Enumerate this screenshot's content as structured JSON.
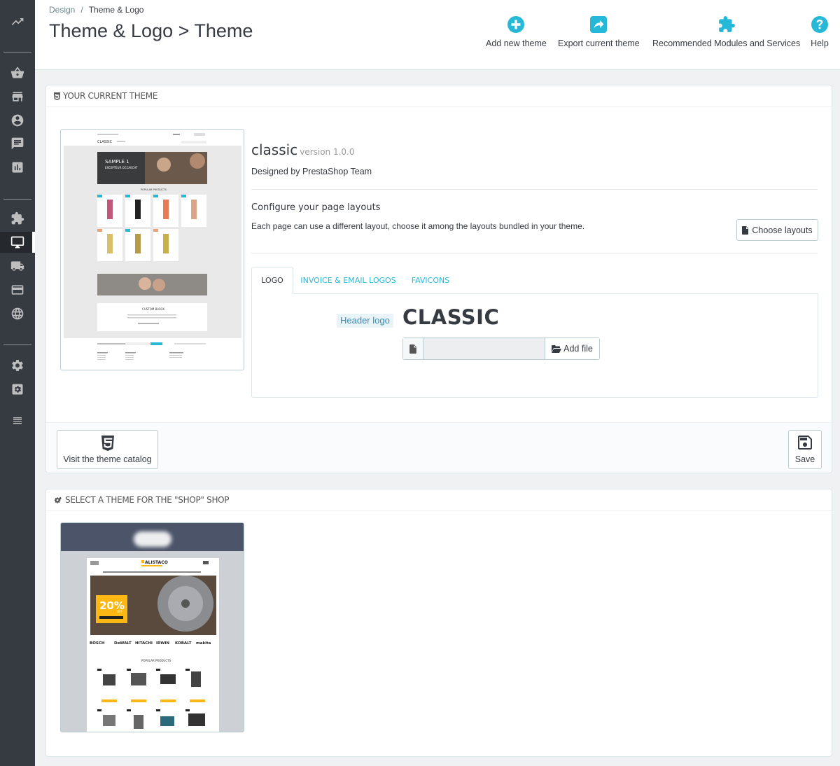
{
  "header": {
    "breadcrumb": [
      "Design",
      "Theme & Logo"
    ],
    "breadcrumb_sep": "/",
    "title": "Theme & Logo > Theme",
    "toolbar": [
      {
        "label": "Add new theme",
        "icon": "plus-circle-icon"
      },
      {
        "label": "Export current theme",
        "icon": "share-icon"
      },
      {
        "label": "Recommended Modules and Services",
        "icon": "puzzle-icon"
      },
      {
        "label": "Help",
        "icon": "help-icon"
      }
    ]
  },
  "sidebar": {
    "items": [
      {
        "name": "dashboard",
        "icon": "trending-up-icon"
      },
      {
        "name": "orders",
        "icon": "basket-icon"
      },
      {
        "name": "catalog",
        "icon": "store-icon"
      },
      {
        "name": "customers",
        "icon": "account-icon"
      },
      {
        "name": "customer-service",
        "icon": "chat-icon"
      },
      {
        "name": "stats",
        "icon": "bar-chart-icon"
      },
      {
        "name": "modules",
        "icon": "puzzle-icon"
      },
      {
        "name": "design",
        "icon": "desktop-icon",
        "active": true
      },
      {
        "name": "shipping",
        "icon": "truck-icon"
      },
      {
        "name": "payment",
        "icon": "credit-card-icon"
      },
      {
        "name": "international",
        "icon": "globe-icon"
      },
      {
        "name": "shop-parameters",
        "icon": "settings-icon"
      },
      {
        "name": "advanced-parameters",
        "icon": "settings-box-icon"
      },
      {
        "name": "more",
        "icon": "menu-icon"
      }
    ]
  },
  "current_theme": {
    "heading": "YOUR CURRENT THEME",
    "name": "classic",
    "version": "version 1.0.0",
    "designed_by": "Designed by PrestaShop Team",
    "layouts_title": "Configure your page layouts",
    "layouts_desc": "Each page can use a different layout, choose it among the layouts bundled in your theme.",
    "choose_layouts": "Choose layouts",
    "tabs": [
      {
        "label": "LOGO",
        "active": true
      },
      {
        "label": "INVOICE & EMAIL LOGOS",
        "active": false
      },
      {
        "label": "FAVICONS",
        "active": false
      }
    ],
    "header_logo_label": "Header logo",
    "logo_text": "CLASSIC",
    "add_file": "Add file",
    "visit_catalog": "Visit the theme catalog",
    "save": "Save",
    "preview": {
      "brand": "CLASSIC",
      "slide_title": "SAMPLE 1",
      "slide_sub": "EXCEPTEUR OCCAECAT",
      "section": "POPULAR PRODUCTS",
      "custom_block": "CUSTOM BLOCK"
    }
  },
  "select_theme": {
    "heading": "SELECT A THEME FOR THE \"SHOP\" SHOP",
    "card_preview": {
      "brand": "ALISTACO",
      "promo": "20%",
      "promo_sub": "OFF",
      "section": "POPULAR PRODUCTS",
      "brands": [
        "BOSCH",
        "DeWALT",
        "HITACHI",
        "IRWIN",
        "KOBALT",
        "makita"
      ]
    }
  },
  "colors": {
    "accent": "#25b9d7",
    "sidebar": "#363a41",
    "promo": "#fbb714"
  }
}
